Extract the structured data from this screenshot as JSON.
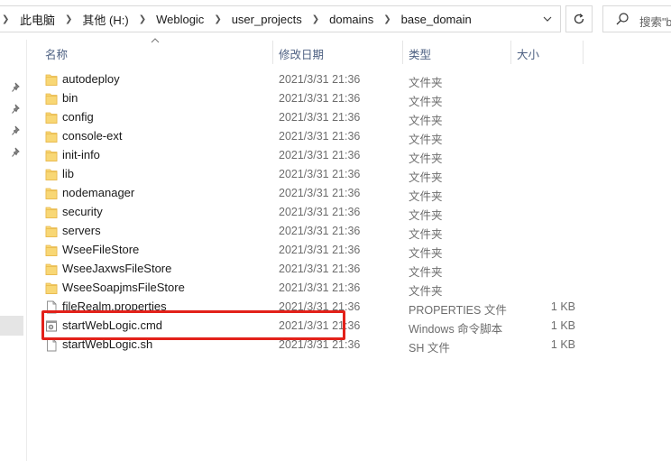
{
  "address_bar": {
    "breadcrumbs": [
      {
        "label": "此电脑"
      },
      {
        "label": "其他 (H:)"
      },
      {
        "label": "Weblogic"
      },
      {
        "label": "user_projects"
      },
      {
        "label": "domains"
      },
      {
        "label": "base_domain"
      }
    ]
  },
  "search": {
    "placeholder": "搜索\"b"
  },
  "columns": {
    "name": "名称",
    "modified": "修改日期",
    "type": "类型",
    "size": "大小"
  },
  "files": [
    {
      "name": "autodeploy",
      "date": "2021/3/31 21:36",
      "type": "文件夹",
      "size": "",
      "kind": "folder"
    },
    {
      "name": "bin",
      "date": "2021/3/31 21:36",
      "type": "文件夹",
      "size": "",
      "kind": "folder"
    },
    {
      "name": "config",
      "date": "2021/3/31 21:36",
      "type": "文件夹",
      "size": "",
      "kind": "folder"
    },
    {
      "name": "console-ext",
      "date": "2021/3/31 21:36",
      "type": "文件夹",
      "size": "",
      "kind": "folder"
    },
    {
      "name": "init-info",
      "date": "2021/3/31 21:36",
      "type": "文件夹",
      "size": "",
      "kind": "folder"
    },
    {
      "name": "lib",
      "date": "2021/3/31 21:36",
      "type": "文件夹",
      "size": "",
      "kind": "folder"
    },
    {
      "name": "nodemanager",
      "date": "2021/3/31 21:36",
      "type": "文件夹",
      "size": "",
      "kind": "folder"
    },
    {
      "name": "security",
      "date": "2021/3/31 21:36",
      "type": "文件夹",
      "size": "",
      "kind": "folder"
    },
    {
      "name": "servers",
      "date": "2021/3/31 21:36",
      "type": "文件夹",
      "size": "",
      "kind": "folder"
    },
    {
      "name": "WseeFileStore",
      "date": "2021/3/31 21:36",
      "type": "文件夹",
      "size": "",
      "kind": "folder"
    },
    {
      "name": "WseeJaxwsFileStore",
      "date": "2021/3/31 21:36",
      "type": "文件夹",
      "size": "",
      "kind": "folder"
    },
    {
      "name": "WseeSoapjmsFileStore",
      "date": "2021/3/31 21:36",
      "type": "文件夹",
      "size": "",
      "kind": "folder"
    },
    {
      "name": "fileRealm.properties",
      "date": "2021/3/31 21:36",
      "type": "PROPERTIES 文件",
      "size": "1 KB",
      "kind": "file"
    },
    {
      "name": "startWebLogic.cmd",
      "date": "2021/3/31 21:36",
      "type": "Windows 命令脚本",
      "size": "1 KB",
      "kind": "cmd"
    },
    {
      "name": "startWebLogic.sh",
      "date": "2021/3/31 21:36",
      "type": "SH 文件",
      "size": "1 KB",
      "kind": "file"
    }
  ],
  "colors": {
    "folder": "#f8d775",
    "folder_dark": "#e8b84a",
    "highlight": "#e3211a",
    "header_text": "#4d6082",
    "meta_text": "#6d6d6d"
  }
}
